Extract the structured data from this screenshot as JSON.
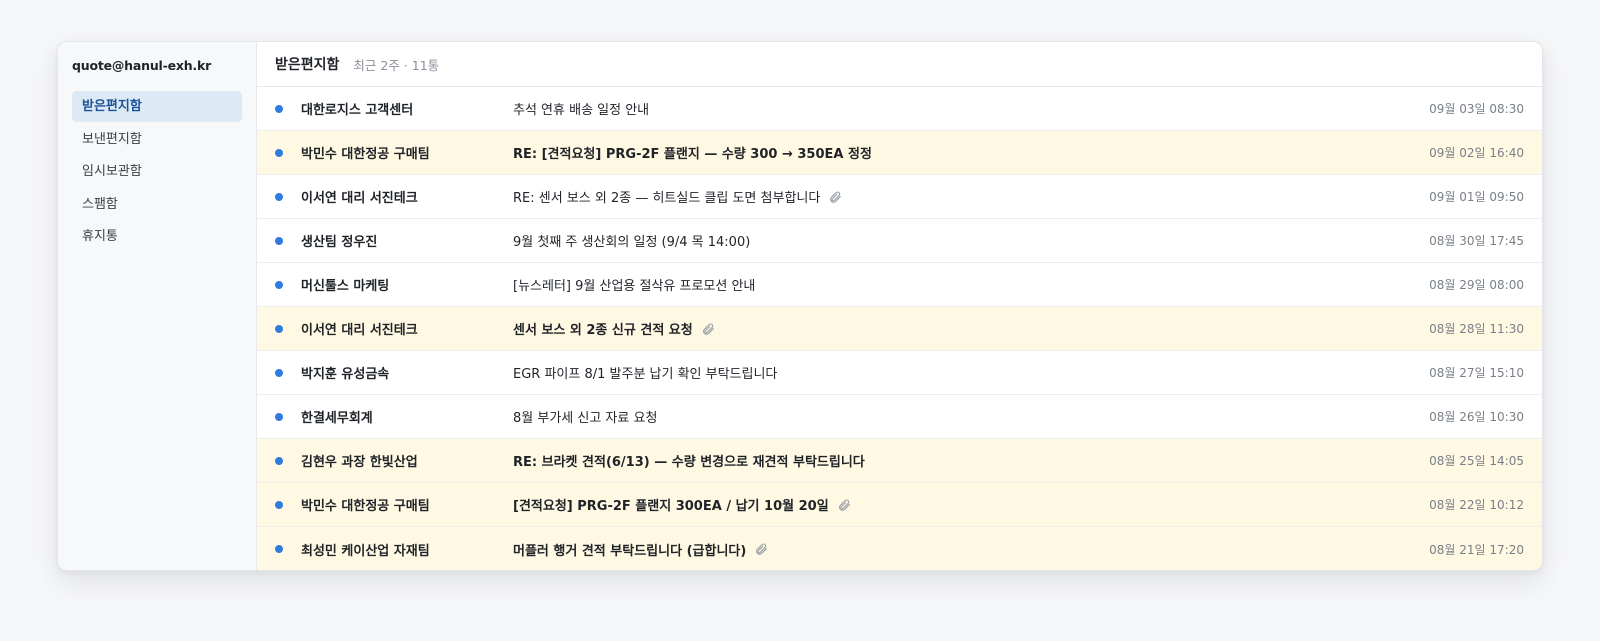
{
  "account": "quote@hanul-exh.kr",
  "folders": [
    {
      "label": "받은편지함",
      "active": true
    },
    {
      "label": "보낸편지함",
      "active": false
    },
    {
      "label": "임시보관함",
      "active": false
    },
    {
      "label": "스팸함",
      "active": false
    },
    {
      "label": "휴지통",
      "active": false
    }
  ],
  "header": {
    "title": "받은편지함",
    "meta": "최근 2주 · 11통"
  },
  "icons": {
    "unread": "unread-dot-icon",
    "attachment": "paperclip-icon"
  },
  "colors": {
    "accent": "#2f7be0",
    "highlight": "#fff8e3",
    "active_folder": "#dde9f5"
  },
  "messages": [
    {
      "sender": "대한로지스 고객센터",
      "subject": "추석 연휴 배송 일정 안내",
      "date": "09월 03일 08:30",
      "highlight": false,
      "attachment": false
    },
    {
      "sender": "박민수 대한정공 구매팀",
      "subject": "RE: [견적요청] PRG-2F 플랜지 — 수량 300 → 350EA 정정",
      "date": "09월 02일 16:40",
      "highlight": true,
      "attachment": false
    },
    {
      "sender": "이서연 대리 서진테크",
      "subject": "RE: 센서 보스 외 2종 — 히트실드 클립 도면 첨부합니다",
      "date": "09월 01일 09:50",
      "highlight": false,
      "attachment": true
    },
    {
      "sender": "생산팀 정우진",
      "subject": "9월 첫째 주 생산회의 일정 (9/4 목 14:00)",
      "date": "08월 30일 17:45",
      "highlight": false,
      "attachment": false
    },
    {
      "sender": "머신툴스 마케팅",
      "subject": "[뉴스레터] 9월 산업용 절삭유 프로모션 안내",
      "date": "08월 29일 08:00",
      "highlight": false,
      "attachment": false
    },
    {
      "sender": "이서연 대리 서진테크",
      "subject": "센서 보스 외 2종 신규 견적 요청",
      "date": "08월 28일 11:30",
      "highlight": true,
      "attachment": true
    },
    {
      "sender": "박지훈 유성금속",
      "subject": "EGR 파이프 8/1 발주분 납기 확인 부탁드립니다",
      "date": "08월 27일 15:10",
      "highlight": false,
      "attachment": false
    },
    {
      "sender": "한결세무회계",
      "subject": "8월 부가세 신고 자료 요청",
      "date": "08월 26일 10:30",
      "highlight": false,
      "attachment": false
    },
    {
      "sender": "김현우 과장 한빛산업",
      "subject": "RE: 브라켓 견적(6/13) — 수량 변경으로 재견적 부탁드립니다",
      "date": "08월 25일 14:05",
      "highlight": true,
      "attachment": false
    },
    {
      "sender": "박민수 대한정공 구매팀",
      "subject": "[견적요청] PRG-2F 플랜지 300EA / 납기 10월 20일",
      "date": "08월 22일 10:12",
      "highlight": true,
      "attachment": true
    },
    {
      "sender": "최성민 케이산업 자재팀",
      "subject": "머플러 행거 견적 부탁드립니다 (급합니다)",
      "date": "08월 21일 17:20",
      "highlight": true,
      "attachment": true
    }
  ]
}
